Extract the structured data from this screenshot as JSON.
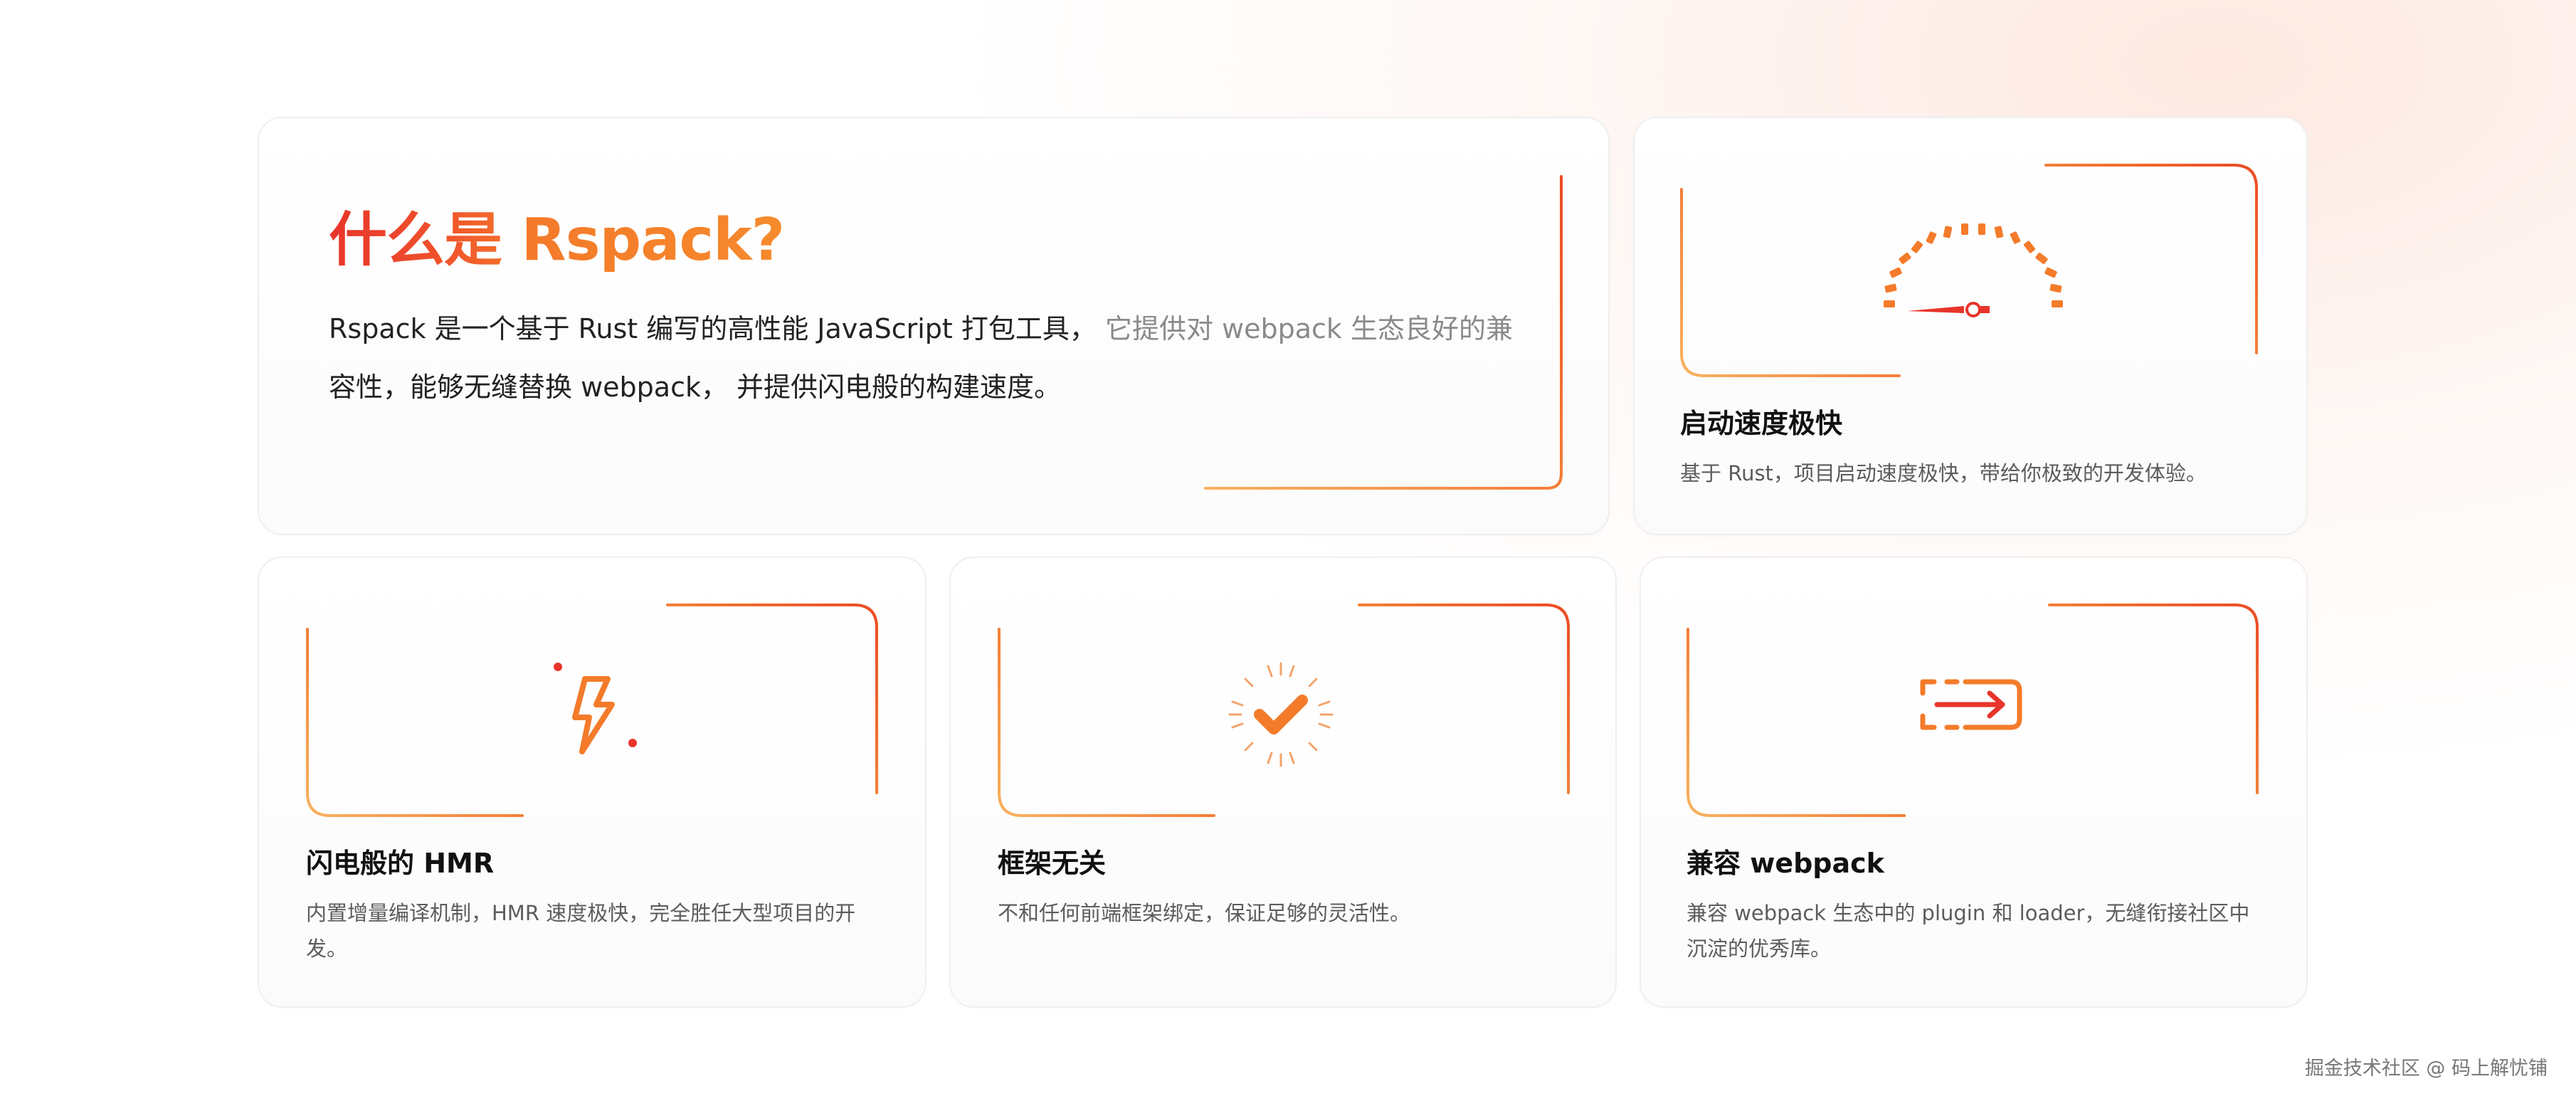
{
  "hero": {
    "title": "什么是 Rspack?",
    "desc_main": "Rspack 是一个基于 Rust 编写的高性能 JavaScript 打包工具，",
    "desc_muted": "它提供对 webpack 生态良好的兼",
    "desc_rest": "容性，能够无缝替换 webpack， 并提供闪电般的构建速度。"
  },
  "features": [
    {
      "title": "启动速度极快",
      "desc": "基于 Rust，项目启动速度极快，带给你极致的开发体验。",
      "icon": "speedometer-icon"
    },
    {
      "title": "闪电般的 HMR",
      "desc": "内置增量编译机制，HMR 速度极快，完全胜任大型项目的开发。",
      "icon": "lightning-icon"
    },
    {
      "title": "框架无关",
      "desc": "不和任何前端框架绑定，保证足够的灵活性。",
      "icon": "check-burst-icon"
    },
    {
      "title": "兼容 webpack",
      "desc": "兼容 webpack 生态中的 plugin 和 loader，无缝衔接社区中沉淀的优秀库。",
      "icon": "migrate-icon"
    }
  ],
  "watermark": "掘金技术社区 @ 码上解忧铺",
  "colors": {
    "accent_red": "#e8342a",
    "accent_orange": "#f68a2c",
    "text_dark": "#111111",
    "text_muted": "#8a8a8a"
  }
}
